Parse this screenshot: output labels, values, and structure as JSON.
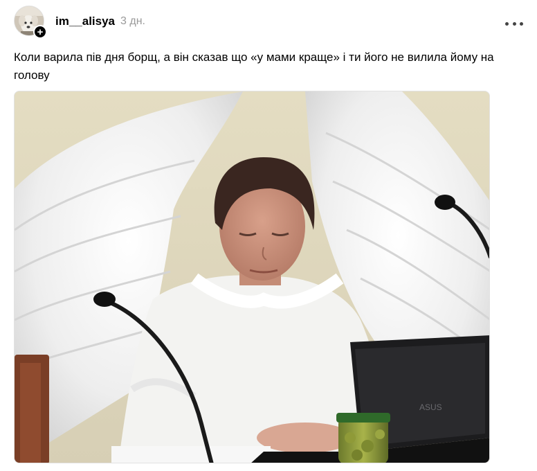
{
  "post": {
    "author": {
      "username": "im__alisya",
      "avatar_icon": "dog-avatar-icon",
      "follow_icon": "plus-icon"
    },
    "timestamp": "3 дн.",
    "more_icon": "more-options-icon",
    "caption": "Коли варила пів дня борщ, а він сказав що «у мами краще» і ти його не вилила йому на голову",
    "image": {
      "brand_text": "ASUS"
    }
  },
  "colors": {
    "background": "#ffffff",
    "text": "#000000",
    "timestamp": "#999999",
    "badge": "#000000"
  }
}
